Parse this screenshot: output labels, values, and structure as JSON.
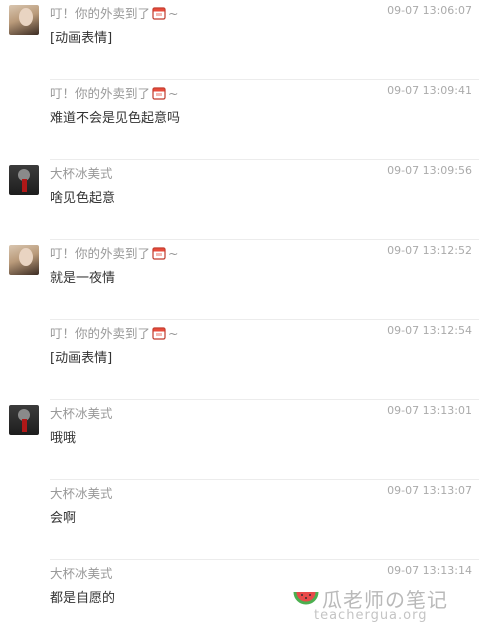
{
  "messages": [
    {
      "sender": "叮！你的外卖到了",
      "emoji_icon": "takeout-cup-icon",
      "suffix": "~",
      "time": "09-07 13:06:07",
      "text": "[动画表情]",
      "avatar": "girl-photo"
    },
    {
      "sender": "叮！你的外卖到了",
      "emoji_icon": "takeout-cup-icon",
      "suffix": "~",
      "time": "09-07 13:09:41",
      "text": "难道不会是见色起意吗",
      "avatar": ""
    },
    {
      "sender": "大杯冰美式",
      "time": "09-07 13:09:56",
      "text": "啥见色起意",
      "avatar": "dark-figure"
    },
    {
      "sender": "叮！你的外卖到了",
      "emoji_icon": "takeout-cup-icon",
      "suffix": "~",
      "time": "09-07 13:12:52",
      "text": "就是一夜情",
      "avatar": "girl-photo"
    },
    {
      "sender": "叮！你的外卖到了",
      "emoji_icon": "takeout-cup-icon",
      "suffix": "~",
      "time": "09-07 13:12:54",
      "text": "[动画表情]",
      "avatar": ""
    },
    {
      "sender": "大杯冰美式",
      "time": "09-07 13:13:01",
      "text": "哦哦",
      "avatar": "dark-figure"
    },
    {
      "sender": "大杯冰美式",
      "time": "09-07 13:13:07",
      "text": "会啊",
      "avatar": ""
    },
    {
      "sender": "大杯冰美式",
      "time": "09-07 13:13:14",
      "text": "都是自愿的",
      "avatar": ""
    }
  ],
  "watermark": {
    "title": "瓜老师の笔记",
    "url": "teachergua.org",
    "icon": "watermelon-icon"
  }
}
